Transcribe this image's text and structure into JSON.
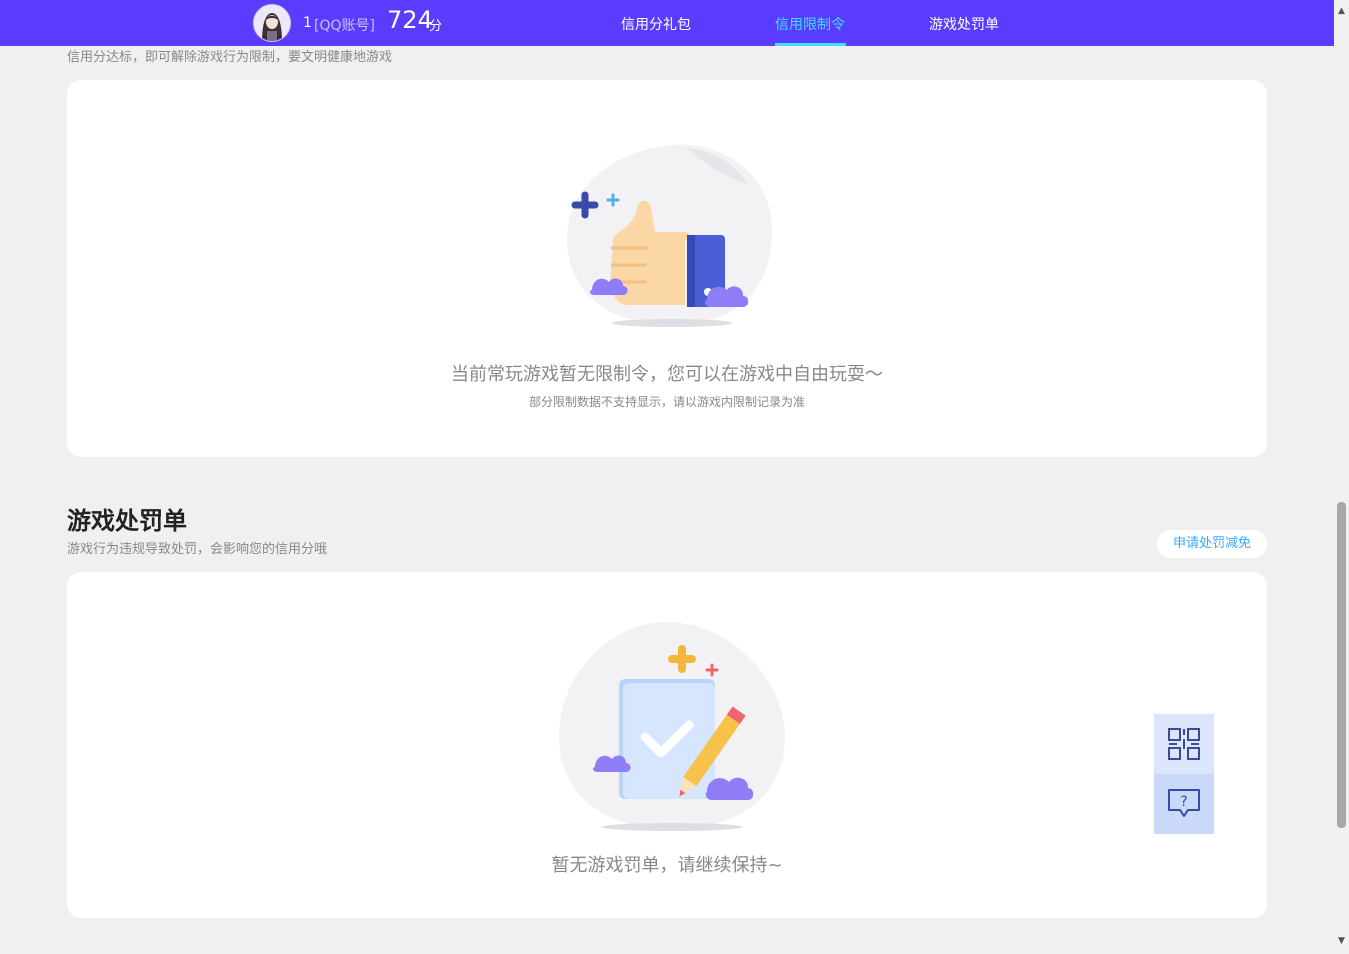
{
  "header": {
    "user_id": "1",
    "qq_tag": "[QQ账号]",
    "score": "724",
    "score_unit": "分",
    "tabs": [
      {
        "label": "信用分礼包"
      },
      {
        "label": "信用限制令"
      },
      {
        "label": "游戏处罚单"
      }
    ],
    "active_tab": "信用限制令"
  },
  "restriction": {
    "desc": "信用分达标，即可解除游戏行为限制，要文明健康地游戏",
    "empty_main": "当前常玩游戏暂无限制令，您可以在游戏中自由玩耍～",
    "empty_sub": "部分限制数据不支持显示，请以游戏内限制记录为准"
  },
  "penalty": {
    "title": "游戏处罚单",
    "desc": "游戏行为违规导致处罚，会影响您的信用分哦",
    "appeal_button": "申请处罚减免",
    "empty_main": "暂无游戏罚单，请继续保持~"
  },
  "float": {
    "qr_icon": "qrcode-icon",
    "help_icon": "help-chat-icon"
  },
  "colors": {
    "brand": "#5a3cff",
    "active_tab": "#3ee0ff",
    "link": "#3aa9ff"
  }
}
